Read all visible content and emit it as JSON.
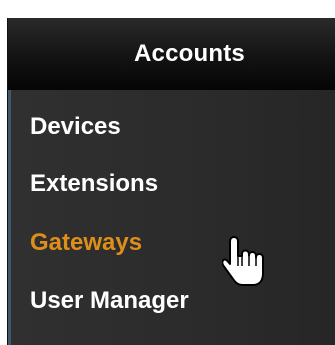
{
  "menu": {
    "title": "Accounts",
    "items": [
      {
        "label": "Devices",
        "active": false
      },
      {
        "label": "Extensions",
        "active": false
      },
      {
        "label": "Gateways",
        "active": true
      },
      {
        "label": "User Manager",
        "active": false
      }
    ]
  },
  "colors": {
    "active_item": "#e08e1a",
    "item_text": "#ffffff",
    "menu_background": "#2c2c2c",
    "header_background": "#0b0b0b"
  },
  "icons": {
    "cursor": "hand-pointer-icon"
  }
}
